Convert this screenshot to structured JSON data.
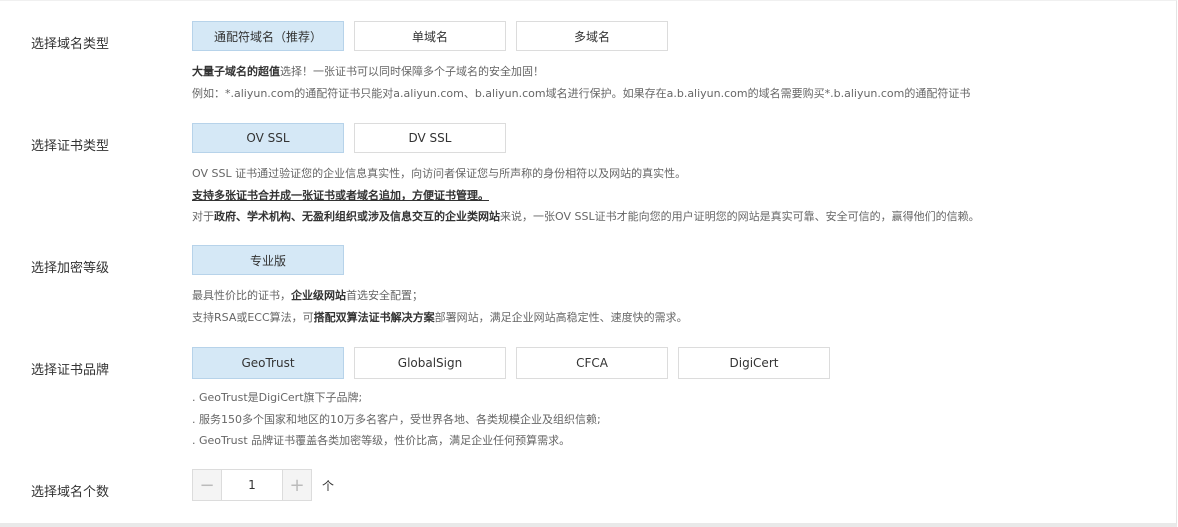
{
  "domain_type": {
    "label": "选择域名类型",
    "options": [
      "通配符域名（推荐）",
      "单域名",
      "多域名"
    ],
    "desc": {
      "line1_bold": "大量子域名的超值",
      "line1_rest": "选择！一张证书可以同时保障多个子域名的安全加固！",
      "line2": "例如：*.aliyun.com的通配符证书只能对a.aliyun.com、b.aliyun.com域名进行保护。如果存在a.b.aliyun.com的域名需要购买*.b.aliyun.com的通配符证书"
    }
  },
  "cert_type": {
    "label": "选择证书类型",
    "options": [
      "OV SSL",
      "DV SSL"
    ],
    "desc": {
      "line1": "OV SSL 证书通过验证您的企业信息真实性，向访问者保证您与所声称的身份相符以及网站的真实性。",
      "line2": "支持多张证书合并成一张证书或者域名追加，方便证书管理。",
      "line3_pre": "对于",
      "line3_bold": "政府、学术机构、无盈利组织或涉及信息交互的企业类网站",
      "line3_post": "来说，一张OV SSL证书才能向您的用户证明您的网站是真实可靠、安全可信的，赢得他们的信赖。"
    }
  },
  "encrypt_level": {
    "label": "选择加密等级",
    "options": [
      "专业版"
    ],
    "desc": {
      "line1_pre": "最具性价比的证书，",
      "line1_bold": "企业级网站",
      "line1_post": "首选安全配置；",
      "line2_pre": "支持RSA或ECC算法，可",
      "line2_bold": "搭配双算法证书解决方案",
      "line2_post": "部署网站，满足企业网站高稳定性、速度快的需求。"
    }
  },
  "brand": {
    "label": "选择证书品牌",
    "options": [
      "GeoTrust",
      "GlobalSign",
      "CFCA",
      "DigiCert"
    ],
    "desc": [
      ". GeoTrust是DigiCert旗下子品牌;",
      ". 服务150多个国家和地区的10万多名客户，受世界各地、各类规模企业及组织信赖;",
      ". GeoTrust 品牌证书覆盖各类加密等级，性价比高，满足企业任何预算需求。"
    ]
  },
  "domain_count": {
    "label": "选择域名个数",
    "value": "1",
    "minus": "−",
    "plus": "+",
    "unit": "个"
  },
  "colors": {
    "selected_bg": "#d5e8f6",
    "border": "#dcdcdc"
  }
}
